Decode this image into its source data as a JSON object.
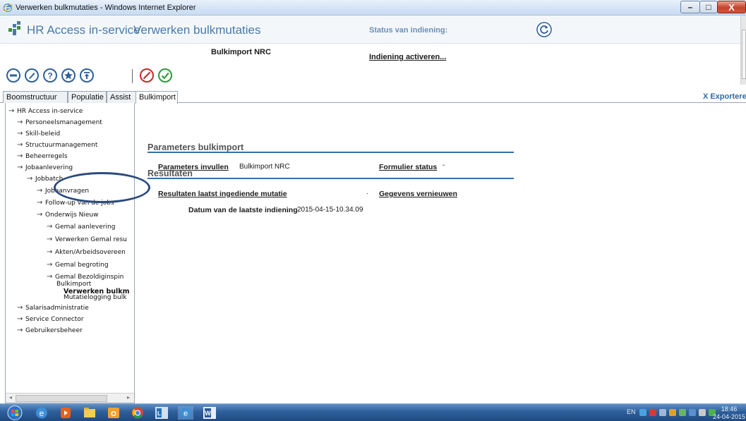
{
  "window": {
    "title": "Verwerken bulkmutaties - Windows Internet Explorer",
    "minimize_glyph": "–",
    "maximize_glyph": "□",
    "close_glyph": "X"
  },
  "header": {
    "app_name": "HR Access in-service",
    "page_name": "Verwerken bulkmutaties",
    "status_label": "Status van indiening:",
    "subtitle": "Bulkimport NRC",
    "indiening_link": "Indiening activeren..."
  },
  "tabs": [
    {
      "label": "Boomstructuur",
      "active": false
    },
    {
      "label": "Populatie",
      "active": false
    },
    {
      "label": "Assist",
      "active": false
    },
    {
      "label": "Bulkimport",
      "active": true
    }
  ],
  "export": {
    "icon": "X",
    "label": "Exporteren"
  },
  "tree": [
    {
      "label": "HR Access in-service",
      "level": 0,
      "arrow": true,
      "bold": false
    },
    {
      "label": "Personeelsmanagement",
      "level": 1,
      "arrow": true,
      "bold": false
    },
    {
      "label": "Skill-beleid",
      "level": 1,
      "arrow": true,
      "bold": false
    },
    {
      "label": "Structuurmanagement",
      "level": 1,
      "arrow": true,
      "bold": false
    },
    {
      "label": "Beheerregels",
      "level": 1,
      "arrow": true,
      "bold": false
    },
    {
      "label": "Jobaanlevering",
      "level": 1,
      "arrow": true,
      "bold": false
    },
    {
      "label": "Jobbatch",
      "level": 2,
      "arrow": true,
      "bold": false
    },
    {
      "label": "Jobaanvragen",
      "level": 3,
      "arrow": true,
      "bold": false
    },
    {
      "label": "Follow-up van de jobs",
      "level": 3,
      "arrow": true,
      "bold": false
    },
    {
      "label": "Onderwijs Nieuw",
      "level": 3,
      "arrow": true,
      "bold": false
    },
    {
      "label": "Gemal aanlevering",
      "level": 4,
      "arrow": true,
      "bold": false
    },
    {
      "label": "Verwerken Gemal resu",
      "level": 4,
      "arrow": true,
      "bold": false
    },
    {
      "label": "Akten/Arbeidsovereen",
      "level": 4,
      "arrow": true,
      "bold": false
    },
    {
      "label": "Gemal begroting",
      "level": 4,
      "arrow": true,
      "bold": false
    },
    {
      "label": "Gemal Bezoldiginspin",
      "level": 4,
      "arrow": true,
      "bold": false
    },
    {
      "label": "Bulkimport",
      "level": 4,
      "arrow": true,
      "bold": false
    },
    {
      "label": "Verwerken bulkm",
      "level": 5,
      "arrow": false,
      "bold": true
    },
    {
      "label": "Mutatielogging bulk",
      "level": 5,
      "arrow": false,
      "bold": false
    },
    {
      "label": "Salarisadministratie",
      "level": 1,
      "arrow": true,
      "bold": false
    },
    {
      "label": "Service Connector",
      "level": 1,
      "arrow": true,
      "bold": false
    },
    {
      "label": "Gebruikersbeheer",
      "level": 1,
      "arrow": true,
      "bold": false
    }
  ],
  "content": {
    "params_title": "Parameters bulkimport",
    "params_link": "Parameters invullen",
    "params_value": "Bulkimport NRC",
    "form_status_label": "Formulier status",
    "form_status_value": "-",
    "results_title": "Resultaten",
    "results_link": "Resultaten laatst ingediende mutatie",
    "results_dot": ".",
    "refresh_link": "Gegevens vernieuwen",
    "date_label": "Datum van de laatste indiening",
    "date_value": "2015-04-15-10.34.09"
  },
  "taskbar": {
    "lang": "EN",
    "time": "18:46",
    "date": "24-04-2015"
  },
  "colors": {
    "accent": "#3a6ea5",
    "header_text": "#4a7aa8",
    "highlight_circle": "#2b4b80"
  }
}
